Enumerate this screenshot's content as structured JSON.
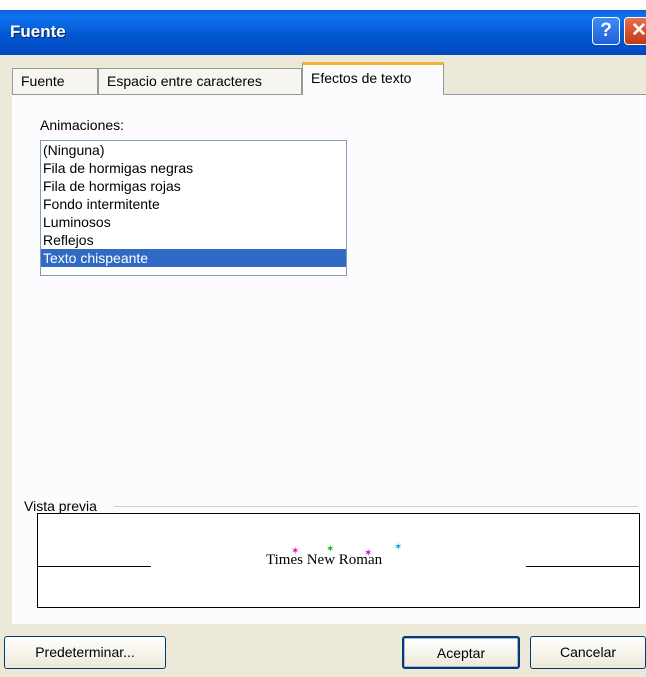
{
  "window": {
    "title": "Fuente"
  },
  "titlebar": {
    "help": "?",
    "close": "✕"
  },
  "tabs": [
    {
      "label": "Fuente"
    },
    {
      "label": "Espacio entre caracteres"
    },
    {
      "label": "Efectos de texto"
    }
  ],
  "animations": {
    "label": "Animaciones:",
    "items": [
      "(Ninguna)",
      "Fila de hormigas negras",
      "Fila de hormigas rojas",
      "Fondo intermitente",
      "Luminosos",
      "Reflejos",
      "Texto chispeante"
    ],
    "selected": "Texto chispeante"
  },
  "preview": {
    "label": "Vista previa",
    "sample_text": "Times New Roman"
  },
  "buttons": {
    "default": "Predeterminar...",
    "ok": "Aceptar",
    "cancel": "Cancelar"
  },
  "colors": {
    "titlebar": "#0258d0",
    "selection": "#316ac5",
    "tab_highlight": "#f4b33d"
  }
}
